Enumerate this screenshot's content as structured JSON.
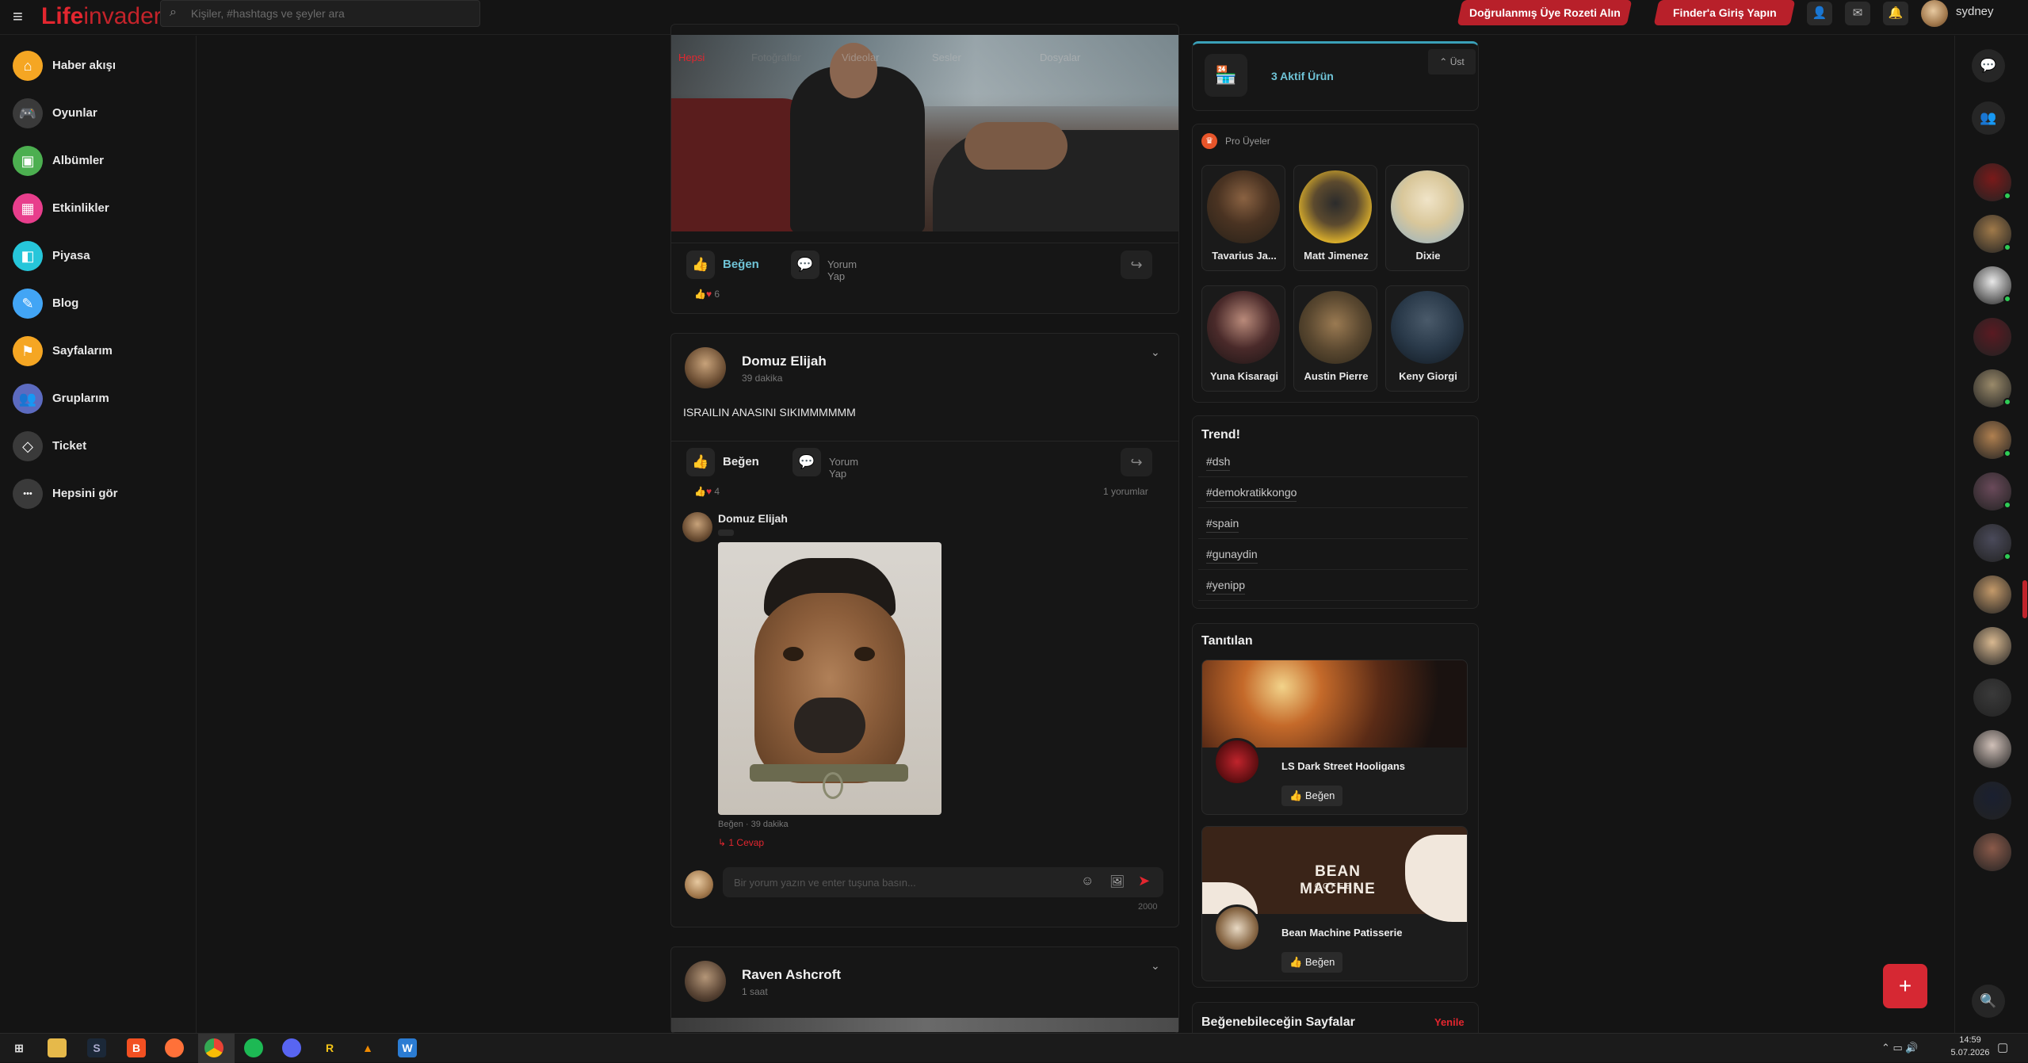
{
  "app": {
    "logo_main": "Life",
    "logo_sub": "invader",
    "search_placeholder": "Kişiler, #hashtags ve şeyler ara",
    "badge_button": "Doğrulanmış Üye Rozeti Alın",
    "finder_button": "Finder'a Giriş Yapın",
    "username": "sydney"
  },
  "sidebar": {
    "items": [
      {
        "label": "Haber akışı",
        "icon": "home-icon",
        "color": "#f5a623"
      },
      {
        "label": "Oyunlar",
        "icon": "gamepad-icon",
        "color": "#3a3a3a"
      },
      {
        "label": "Albümler",
        "icon": "album-icon",
        "color": "#4caf50"
      },
      {
        "label": "Etkinlikler",
        "icon": "calendar-icon",
        "color": "#e83e8c"
      },
      {
        "label": "Piyasa",
        "icon": "shop-icon",
        "color": "#26c6da"
      },
      {
        "label": "Blog",
        "icon": "blog-icon",
        "color": "#42a5f5"
      },
      {
        "label": "Sayfalarım",
        "icon": "flag-icon",
        "color": "#f5a623"
      },
      {
        "label": "Gruplarım",
        "icon": "group-icon",
        "color": "#5c6bc0"
      },
      {
        "label": "Ticket",
        "icon": "ticket-icon",
        "color": "#3a3a3a"
      },
      {
        "label": "Hepsini gör",
        "icon": "more-icon",
        "color": "#3a3a3a"
      }
    ]
  },
  "post1": {
    "tabs": [
      "Hepsi",
      "Fotoğraflar",
      "Videolar",
      "Sesler",
      "Dosyalar"
    ],
    "like_label": "Beğen",
    "comment_label": "Yorum Yap",
    "reaction_count": "6"
  },
  "post2": {
    "author": "Domuz Elijah",
    "time": "39 dakika",
    "text": "ISRAILIN ANASINI SIKIMMMMMM",
    "like_label": "Beğen",
    "comment_label": "Yorum Yap",
    "reaction_count": "4",
    "comment_count": "1 yorumlar",
    "comment": {
      "author": "Domuz Elijah",
      "meta": "Beğen · 39 dakika",
      "replies": "1 Cevap"
    },
    "comment_placeholder": "Bir yorum yazın ve enter tuşuna basın...",
    "char_limit": "2000"
  },
  "post3": {
    "author": "Raven Ashcroft",
    "time": "1 saat"
  },
  "right": {
    "active_products": "3 Aktif Ürün",
    "top_button": "Üst",
    "pro_title": "Pro Üyeler",
    "pro_members": [
      "Tavarius Ja...",
      "Matt Jimenez",
      "Dixie",
      "Yuna Kisaragi",
      "Austin Pierre",
      "Keny Giorgi"
    ],
    "trend_title": "Trend!",
    "trends": [
      "#dsh",
      "#demokratikkongo",
      "#spain",
      "#gunaydin",
      "#yenipp"
    ],
    "promoted_title": "Tanıtılan",
    "promoted": [
      {
        "name": "LS Dark Street Hooligans",
        "like": "Beğen"
      },
      {
        "name": "Bean Machine Patisserie",
        "like": "Beğen",
        "banner_line1": "BEAN MACHINE",
        "banner_line2": "COFFEE"
      }
    ],
    "suggest_title": "Beğenebileceğin Sayfalar",
    "refresh": "Yenile"
  },
  "taskbar": {
    "time": "14:59",
    "date": "5.07.2026"
  },
  "colors": {
    "accent": "#e3262f",
    "online": "#2ecc55",
    "link": "#6fc3d6"
  }
}
